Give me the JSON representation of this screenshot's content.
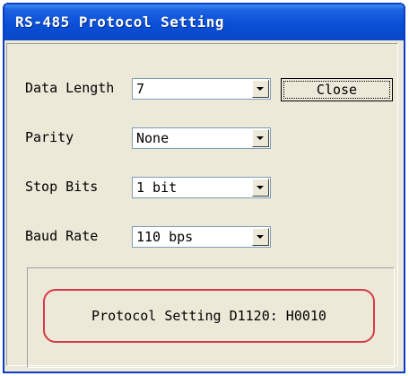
{
  "window": {
    "title": "RS-485 Protocol Setting"
  },
  "fields": [
    {
      "label": "Data Length",
      "value": "7"
    },
    {
      "label": "Parity",
      "value": "None"
    },
    {
      "label": "Stop Bits",
      "value": "1 bit"
    },
    {
      "label": "Baud Rate",
      "value": "110 bps"
    }
  ],
  "buttons": {
    "close_label": "Close"
  },
  "status": {
    "text": "Protocol Setting D1120: H0010"
  },
  "colors": {
    "titlebar": "#0a4fd8",
    "highlight_border": "#d63a4a",
    "dialog_bg": "#ece9d8"
  },
  "icons": {
    "dropdown": "chevron-down-icon"
  }
}
